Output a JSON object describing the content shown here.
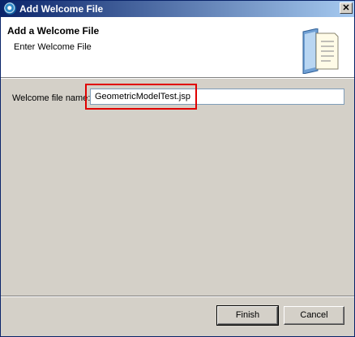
{
  "window": {
    "title": "Add Welcome File",
    "close_label": "✕"
  },
  "header": {
    "title": "Add a Welcome File",
    "description": "Enter Welcome File"
  },
  "form": {
    "welcome_label": "Welcome file name:",
    "welcome_value": "GeometricModelTest.jsp"
  },
  "buttons": {
    "finish": "Finish",
    "cancel": "Cancel"
  },
  "colors": {
    "titlebar_start": "#0a246a",
    "titlebar_end": "#a6caf0",
    "highlight": "#e00000"
  },
  "icons": {
    "app": "eclipse-app-icon",
    "wizard": "file-document-icon"
  }
}
